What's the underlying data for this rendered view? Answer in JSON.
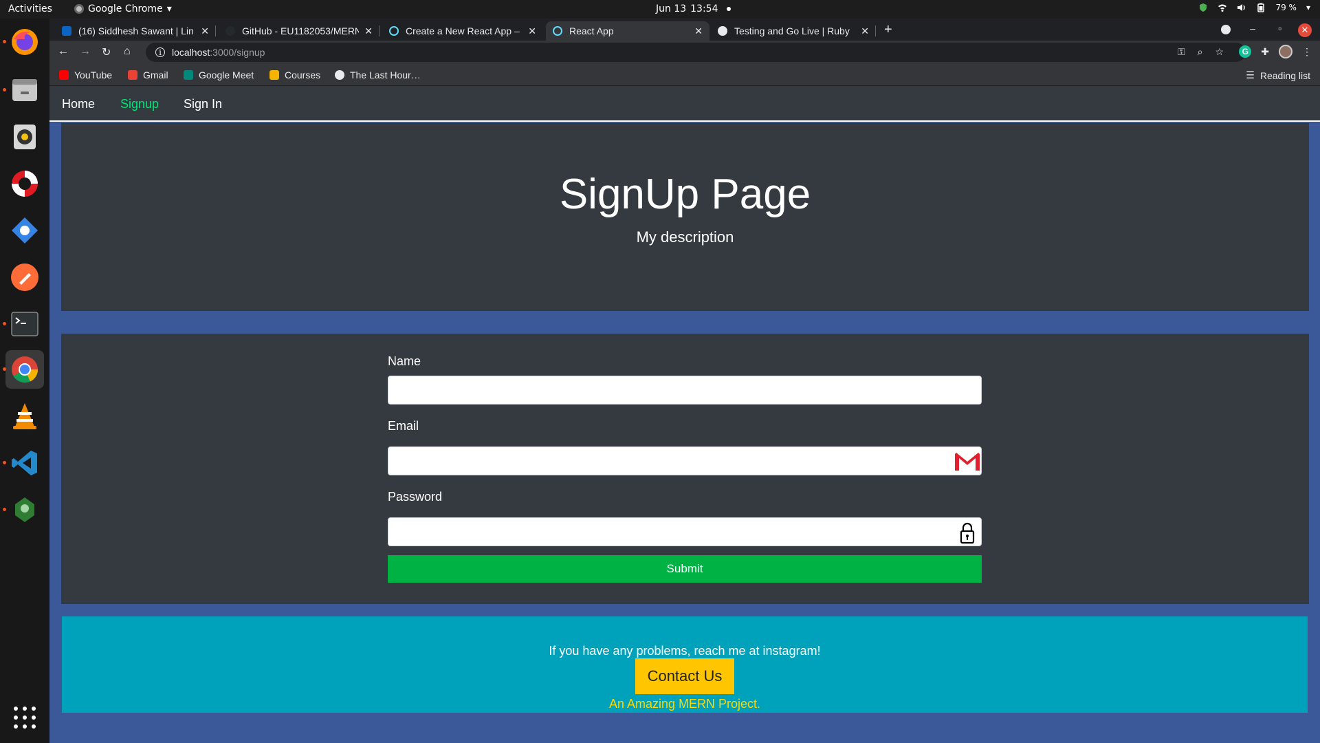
{
  "system": {
    "activities": "Activities",
    "app_name": "Google Chrome",
    "date": "Jun 13",
    "time": "13:54",
    "battery": "79 %"
  },
  "dock": {
    "apps": [
      "firefox",
      "files",
      "rhythmbox",
      "help",
      "software-updater",
      "postman",
      "terminal",
      "chrome",
      "vlc",
      "vscode",
      "robo3t"
    ]
  },
  "browser": {
    "tabs": [
      {
        "title": "(16) Siddhesh Sawant | Lin",
        "icon": "linkedin-icon"
      },
      {
        "title": "GitHub - EU1182053/MERN",
        "icon": "github-icon"
      },
      {
        "title": "Create a New React App –",
        "icon": "react-icon"
      },
      {
        "title": "React App",
        "icon": "react-icon"
      },
      {
        "title": "Testing and Go Live | Ruby",
        "icon": "globe-icon"
      }
    ],
    "url_host": "localhost",
    "url_path": ":3000/signup",
    "bookmarks": [
      "YouTube",
      "Gmail",
      "Google Meet",
      "Courses",
      "The Last Hour…"
    ],
    "reading_list": "Reading list",
    "extension_letter": "G"
  },
  "nav": {
    "home": "Home",
    "signup": "Signup",
    "signin": "Sign In"
  },
  "hero": {
    "title": "SignUp Page",
    "description": "My description"
  },
  "form": {
    "name_label": "Name",
    "email_label": "Email",
    "password_label": "Password",
    "name_value": "",
    "email_value": "",
    "password_value": "",
    "submit_label": "Submit"
  },
  "footer": {
    "message": "If you have any problems, reach me at instagram!",
    "contact_label": "Contact Us",
    "tagline": "An Amazing MERN Project."
  },
  "colors": {
    "page_bg": "#3b5998",
    "panel_bg": "#343a40",
    "nav_active": "#00e676",
    "submit_bg": "#00b144",
    "footer_bg": "#00a2bb",
    "contact_bg": "#ffc600",
    "tagline": "#ffd800"
  }
}
